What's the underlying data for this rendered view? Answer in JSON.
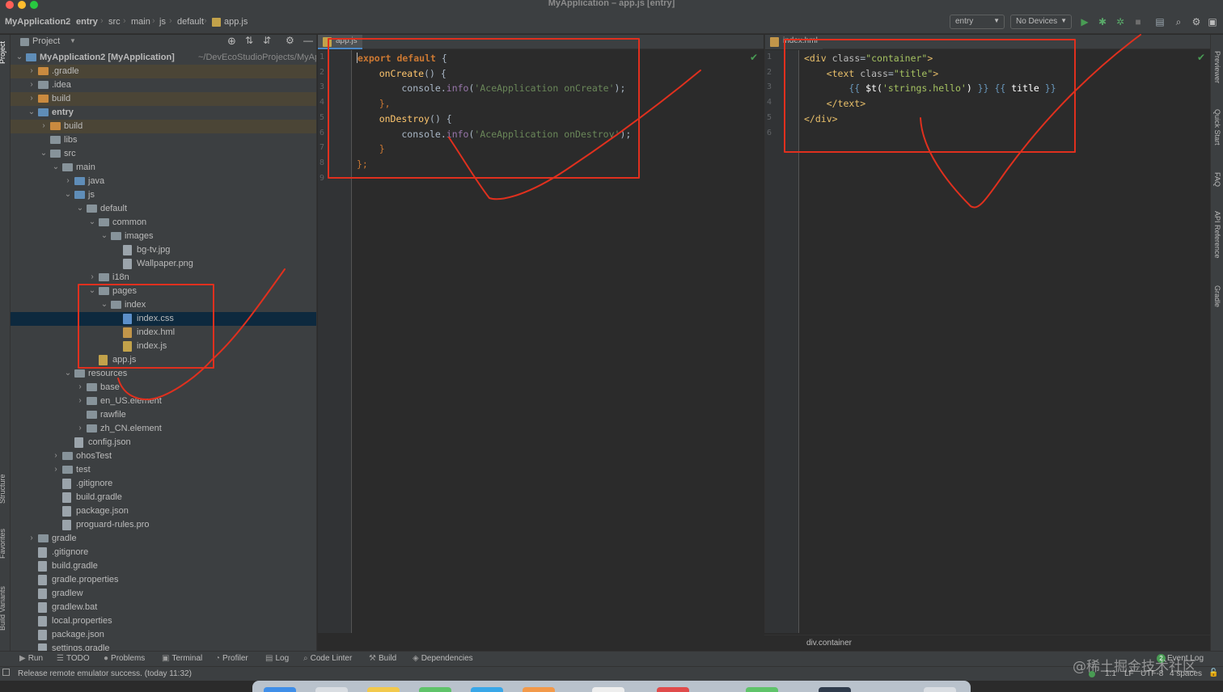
{
  "window": {
    "title": "MyApplication – app.js [entry]"
  },
  "breadcrumb": {
    "items": [
      "MyApplication2",
      "entry",
      "src",
      "main",
      "js",
      "default",
      "app.js"
    ]
  },
  "toolbar": {
    "run_config": "entry",
    "device": "No Devices",
    "icons": [
      "run-icon",
      "debug-icon",
      "attach-debugger-icon",
      "stop-icon",
      "project-structure-icon",
      "search-icon",
      "settings-icon"
    ]
  },
  "left_strip": {
    "labels": [
      "Project",
      "Structure",
      "Favorites",
      "Build Variants"
    ]
  },
  "right_strip": {
    "labels": [
      "Previewer",
      "Quick Start",
      "FAQ",
      "API Reference",
      "Gradle"
    ]
  },
  "project_panel": {
    "title": "Project",
    "tree": [
      {
        "label": "MyApplication2 [MyApplication]",
        "suffix": "~/DevEcoStudioProjects/MyApplica",
        "depth": 0,
        "expanded": true,
        "icon": "module",
        "bold": true
      },
      {
        "label": ".gradle",
        "depth": 1,
        "expanded": false,
        "icon": "folder-orange",
        "excluded": true
      },
      {
        "label": ".idea",
        "depth": 1,
        "expanded": false,
        "icon": "folder"
      },
      {
        "label": "build",
        "depth": 1,
        "expanded": false,
        "icon": "folder-orange",
        "excluded": true
      },
      {
        "label": "entry",
        "depth": 1,
        "expanded": true,
        "icon": "module",
        "bold": true
      },
      {
        "label": "build",
        "depth": 2,
        "expanded": false,
        "icon": "folder-orange",
        "excluded": true
      },
      {
        "label": "libs",
        "depth": 2,
        "icon": "folder"
      },
      {
        "label": "src",
        "depth": 2,
        "expanded": true,
        "icon": "folder"
      },
      {
        "label": "main",
        "depth": 3,
        "expanded": true,
        "icon": "folder"
      },
      {
        "label": "java",
        "depth": 4,
        "expanded": false,
        "icon": "folder-blue"
      },
      {
        "label": "js",
        "depth": 4,
        "expanded": true,
        "icon": "folder-blue"
      },
      {
        "label": "default",
        "depth": 5,
        "expanded": true,
        "icon": "folder"
      },
      {
        "label": "common",
        "depth": 6,
        "expanded": true,
        "icon": "folder"
      },
      {
        "label": "images",
        "depth": 7,
        "expanded": true,
        "icon": "folder"
      },
      {
        "label": "bg-tv.jpg",
        "depth": 8,
        "icon": "file"
      },
      {
        "label": "Wallpaper.png",
        "depth": 8,
        "icon": "file"
      },
      {
        "label": "i18n",
        "depth": 6,
        "expanded": false,
        "icon": "folder"
      },
      {
        "label": "pages",
        "depth": 6,
        "expanded": true,
        "icon": "folder"
      },
      {
        "label": "index",
        "depth": 7,
        "expanded": true,
        "icon": "folder"
      },
      {
        "label": "index.css",
        "depth": 8,
        "icon": "file-css",
        "selected": true
      },
      {
        "label": "index.hml",
        "depth": 8,
        "icon": "file-hml"
      },
      {
        "label": "index.js",
        "depth": 8,
        "icon": "file-js"
      },
      {
        "label": "app.js",
        "depth": 6,
        "icon": "file-js"
      },
      {
        "label": "resources",
        "depth": 4,
        "expanded": true,
        "icon": "folder"
      },
      {
        "label": "base",
        "depth": 5,
        "expanded": false,
        "icon": "folder"
      },
      {
        "label": "en_US.element",
        "depth": 5,
        "expanded": false,
        "icon": "folder"
      },
      {
        "label": "rawfile",
        "depth": 5,
        "icon": "folder"
      },
      {
        "label": "zh_CN.element",
        "depth": 5,
        "expanded": false,
        "icon": "folder"
      },
      {
        "label": "config.json",
        "depth": 4,
        "icon": "file"
      },
      {
        "label": "ohosTest",
        "depth": 3,
        "expanded": false,
        "icon": "folder"
      },
      {
        "label": "test",
        "depth": 3,
        "expanded": false,
        "icon": "folder"
      },
      {
        "label": ".gitignore",
        "depth": 3,
        "icon": "file"
      },
      {
        "label": "build.gradle",
        "depth": 3,
        "icon": "file"
      },
      {
        "label": "package.json",
        "depth": 3,
        "icon": "file"
      },
      {
        "label": "proguard-rules.pro",
        "depth": 3,
        "icon": "file"
      },
      {
        "label": "gradle",
        "depth": 1,
        "expanded": false,
        "icon": "folder"
      },
      {
        "label": ".gitignore",
        "depth": 1,
        "icon": "file"
      },
      {
        "label": "build.gradle",
        "depth": 1,
        "icon": "file"
      },
      {
        "label": "gradle.properties",
        "depth": 1,
        "icon": "file"
      },
      {
        "label": "gradlew",
        "depth": 1,
        "icon": "file"
      },
      {
        "label": "gradlew.bat",
        "depth": 1,
        "icon": "file"
      },
      {
        "label": "local.properties",
        "depth": 1,
        "icon": "file"
      },
      {
        "label": "package.json",
        "depth": 1,
        "icon": "file"
      },
      {
        "label": "settings.gradle",
        "depth": 1,
        "icon": "file"
      }
    ]
  },
  "editor_left": {
    "tab": "app.js",
    "lines": [
      [
        {
          "t": "export default ",
          "c": "#cc7832",
          "b": true
        },
        {
          "t": "{",
          "c": "#a9b7c6"
        }
      ],
      [
        {
          "t": "    onCreate",
          "c": "#ffc66d"
        },
        {
          "t": "() {",
          "c": "#a9b7c6"
        }
      ],
      [
        {
          "t": "        console.",
          "c": "#a9b7c6"
        },
        {
          "t": "info",
          "c": "#9876aa"
        },
        {
          "t": "(",
          "c": "#a9b7c6"
        },
        {
          "t": "'AceApplication onCreate'",
          "c": "#6a8759"
        },
        {
          "t": ");",
          "c": "#a9b7c6"
        }
      ],
      [
        {
          "t": "    },",
          "c": "#cc7832"
        }
      ],
      [
        {
          "t": "    onDestroy",
          "c": "#ffc66d"
        },
        {
          "t": "() {",
          "c": "#a9b7c6"
        }
      ],
      [
        {
          "t": "        console.",
          "c": "#a9b7c6"
        },
        {
          "t": "info",
          "c": "#9876aa"
        },
        {
          "t": "(",
          "c": "#a9b7c6"
        },
        {
          "t": "'AceApplication onDestroy'",
          "c": "#6a8759"
        },
        {
          "t": ");",
          "c": "#a9b7c6"
        }
      ],
      [
        {
          "t": "    }",
          "c": "#cc7832"
        }
      ],
      [
        {
          "t": "};",
          "c": "#cc7832"
        }
      ],
      []
    ],
    "line_numbers": [
      "1",
      "2",
      "3",
      "4",
      "5",
      "6",
      "7",
      "8",
      "9"
    ]
  },
  "editor_right": {
    "tab": "index.hml",
    "lines": [
      [
        {
          "t": "<div ",
          "c": "#e8bf6a"
        },
        {
          "t": "class",
          "c": "#bababa"
        },
        {
          "t": "=",
          "c": "#a9b7c6"
        },
        {
          "t": "\"container\"",
          "c": "#a5c261"
        },
        {
          "t": ">",
          "c": "#e8bf6a"
        }
      ],
      [
        {
          "t": "    <text ",
          "c": "#e8bf6a"
        },
        {
          "t": "class",
          "c": "#bababa"
        },
        {
          "t": "=",
          "c": "#a9b7c6"
        },
        {
          "t": "\"title\"",
          "c": "#a5c261"
        },
        {
          "t": ">",
          "c": "#e8bf6a"
        }
      ],
      [
        {
          "t": "        {{ ",
          "c": "#6897bb"
        },
        {
          "t": "$t(",
          "c": "#ffffff"
        },
        {
          "t": "'strings.hello'",
          "c": "#a5c261"
        },
        {
          "t": ") ",
          "c": "#ffffff"
        },
        {
          "t": "}} {{ ",
          "c": "#6897bb"
        },
        {
          "t": "title ",
          "c": "#ffffff"
        },
        {
          "t": "}}",
          "c": "#6897bb"
        }
      ],
      [
        {
          "t": "    </text>",
          "c": "#e8bf6a"
        }
      ],
      [
        {
          "t": "</div>",
          "c": "#e8bf6a"
        }
      ],
      []
    ],
    "line_numbers": [
      "1",
      "2",
      "3",
      "4",
      "5",
      "6"
    ],
    "breadcrumb": "div.container"
  },
  "tool_windows": [
    {
      "label": "Run",
      "icon": "run-icon"
    },
    {
      "label": "TODO",
      "icon": "todo-icon"
    },
    {
      "label": "Problems",
      "icon": "problems-icon"
    },
    {
      "label": "Terminal",
      "icon": "terminal-icon"
    },
    {
      "label": "Profiler",
      "icon": "profiler-icon"
    },
    {
      "label": "Log",
      "icon": "log-icon"
    },
    {
      "label": "Code Linter",
      "icon": "code-linter-icon"
    },
    {
      "label": "Build",
      "icon": "build-icon"
    },
    {
      "label": "Dependencies",
      "icon": "dependencies-icon"
    }
  ],
  "event_log": {
    "label": "Event Log",
    "count": "2"
  },
  "statusbar": {
    "message": "Release remote emulator success. (today 11:32)",
    "position": "1:1",
    "line_sep": "LF",
    "encoding": "UTF-8",
    "indent": "4 spaces"
  },
  "watermark": "@稀土掘金技术社区"
}
